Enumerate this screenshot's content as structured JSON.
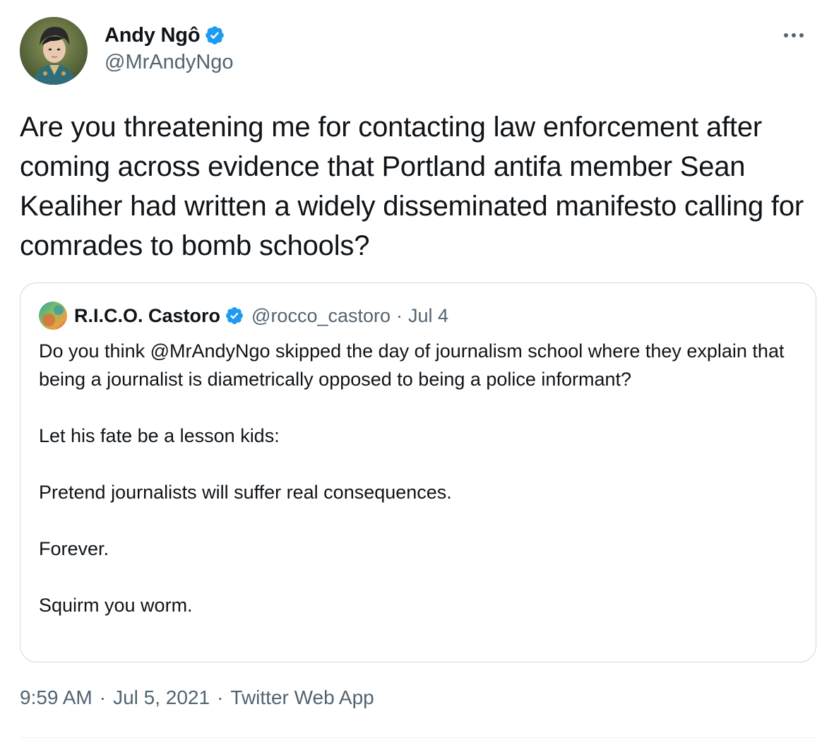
{
  "tweet": {
    "author_name": "Andy Ngô",
    "author_handle": "@MrAndyNgo",
    "text": "Are you threatening me for contacting law enforcement after coming across evidence that Portland antifa member Sean Kealiher had written a widely disseminated manifesto calling for comrades to bomb schools?",
    "time": "9:59 AM",
    "date": "Jul 5, 2021",
    "source": "Twitter Web App",
    "separator": "·",
    "verified": true
  },
  "quoted": {
    "author_name": "R.I.C.O. Castoro",
    "author_handle": "@rocco_castoro",
    "separator": "·",
    "date": "Jul 4",
    "verified": true,
    "paragraphs": [
      "Do you think @MrAndyNgo skipped the day of journalism school where they explain that being a journalist is diametrically opposed to being a police informant?",
      "Let his fate be a lesson kids:",
      "Pretend journalists will suffer real consequences.",
      "Forever.",
      "Squirm you worm."
    ]
  },
  "icons": {
    "verified": "verified-badge-icon",
    "more": "more-dots-icon"
  },
  "colors": {
    "verified_blue": "#1d9bf0",
    "secondary_text": "#536471",
    "primary_text": "#0f1419",
    "border": "#cfd9de"
  }
}
